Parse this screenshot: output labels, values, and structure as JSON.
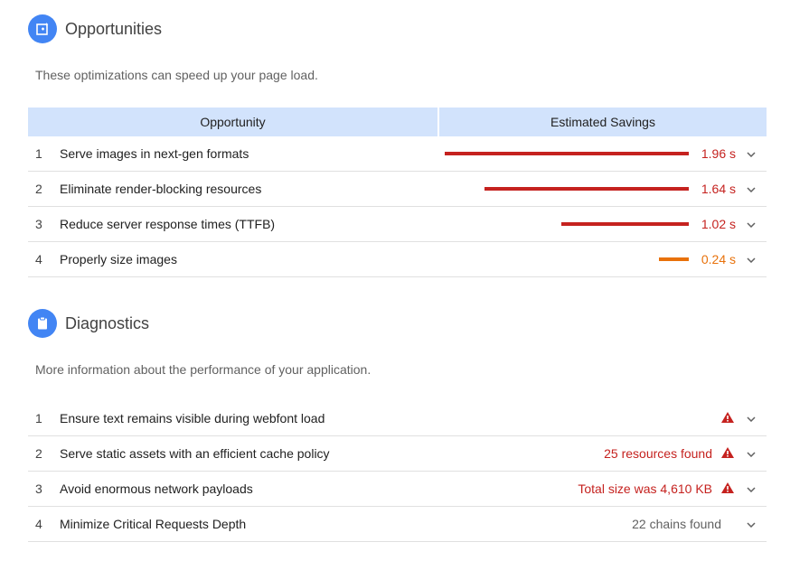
{
  "opportunities": {
    "title": "Opportunities",
    "description": "These optimizations can speed up your page load.",
    "headers": {
      "opportunity": "Opportunity",
      "savings": "Estimated Savings"
    },
    "max_savings_s": 1.96,
    "items": [
      {
        "num": "1",
        "label": "Serve images in next-gen formats",
        "value": "1.96 s",
        "seconds": 1.96,
        "color": "#c5221f"
      },
      {
        "num": "2",
        "label": "Eliminate render-blocking resources",
        "value": "1.64 s",
        "seconds": 1.64,
        "color": "#c5221f"
      },
      {
        "num": "3",
        "label": "Reduce server response times (TTFB)",
        "value": "1.02 s",
        "seconds": 1.02,
        "color": "#c5221f"
      },
      {
        "num": "4",
        "label": "Properly size images",
        "value": "0.24 s",
        "seconds": 0.24,
        "color": "#e8710a"
      }
    ]
  },
  "diagnostics": {
    "title": "Diagnostics",
    "description": "More information about the performance of your application.",
    "items": [
      {
        "num": "1",
        "label": "Ensure text remains visible during webfont load",
        "value": "",
        "warning": true,
        "color": "#c5221f"
      },
      {
        "num": "2",
        "label": "Serve static assets with an efficient cache policy",
        "value": "25 resources found",
        "warning": true,
        "color": "#c5221f"
      },
      {
        "num": "3",
        "label": "Avoid enormous network payloads",
        "value": "Total size was 4,610 KB",
        "warning": true,
        "color": "#c5221f"
      },
      {
        "num": "4",
        "label": "Minimize Critical Requests Depth",
        "value": "22 chains found",
        "warning": false,
        "color": "#616161"
      }
    ]
  },
  "colors": {
    "accent": "#4285f4",
    "header_bg": "#d2e3fc",
    "fail": "#c5221f",
    "average": "#e8710a"
  }
}
